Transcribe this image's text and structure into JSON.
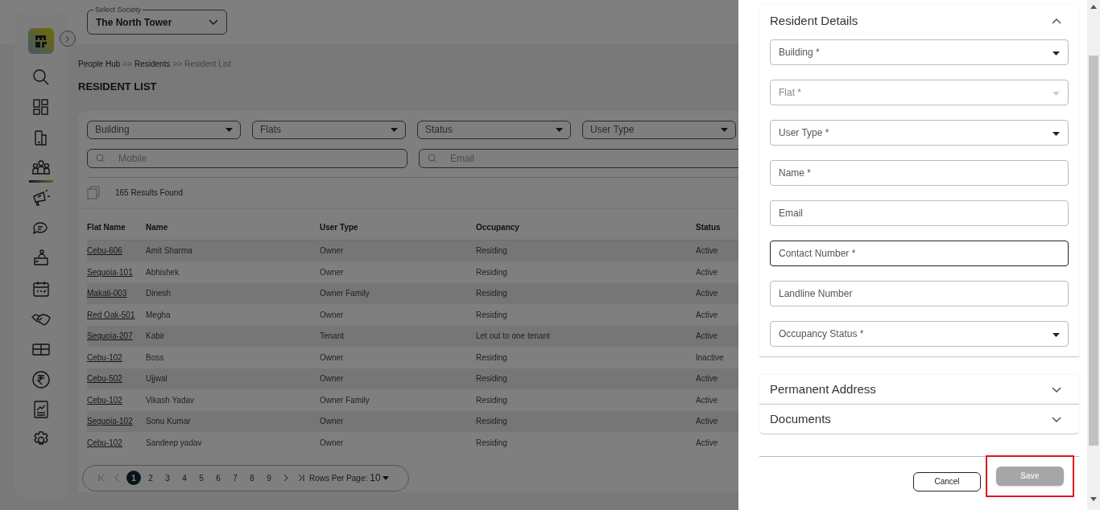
{
  "society_select": {
    "label": "Select Society",
    "value": "The North Tower"
  },
  "nav_items": [
    {
      "kind": "search",
      "selected": false
    },
    {
      "kind": "grid",
      "selected": false
    },
    {
      "kind": "building",
      "selected": false
    },
    {
      "kind": "people",
      "selected": true
    },
    {
      "kind": "megaphone",
      "selected": false
    },
    {
      "kind": "chat",
      "selected": false
    },
    {
      "kind": "desk",
      "selected": false
    },
    {
      "kind": "calendar",
      "selected": false
    },
    {
      "kind": "handshake",
      "selected": false
    },
    {
      "kind": "box",
      "selected": false
    },
    {
      "kind": "rupee",
      "selected": false
    },
    {
      "kind": "report",
      "selected": false
    },
    {
      "kind": "settings",
      "selected": false
    }
  ],
  "breadcrumb": [
    {
      "label": "People Hub",
      "current": false
    },
    {
      "label": "Residents",
      "current": false
    },
    {
      "label": "Resident List",
      "current": true
    }
  ],
  "breadcrumb_separator": ">>",
  "page_title": "RESIDENT LIST",
  "filters": {
    "dropdowns": [
      "Building",
      "Flats",
      "Status",
      "User Type"
    ],
    "search_fields": [
      {
        "placeholder": "Mobile"
      },
      {
        "placeholder": "Email"
      }
    ]
  },
  "results_count": "165 Results Found",
  "table": {
    "columns": [
      "Flat Name",
      "Name",
      "User Type",
      "Occupancy",
      "Status"
    ],
    "rows": [
      [
        "Cebu-606",
        "Amit Sharma",
        "Owner",
        "Residing",
        "Active"
      ],
      [
        "Sequoia-101",
        "Abhishek",
        "Owner",
        "Residing",
        "Active"
      ],
      [
        "Makati-003",
        "Dinesh",
        "Owner Family",
        "Residing",
        "Active"
      ],
      [
        "Red Oak-501",
        "Megha",
        "Owner",
        "Residing",
        "Active"
      ],
      [
        "Sequoia-207",
        "Kabir",
        "Tenant",
        "Let out to one tenant",
        "Active"
      ],
      [
        "Cebu-102",
        "Boss",
        "Owner",
        "Residing",
        "Inactive"
      ],
      [
        "Cebu-502",
        "Ujjwal",
        "Owner",
        "Residing",
        "Active"
      ],
      [
        "Cebu-102",
        "Vikash Yadav",
        "Owner Family",
        "Residing",
        "Active"
      ],
      [
        "Sequoia-102",
        "Sonu Kumar",
        "Owner",
        "Residing",
        "Active"
      ],
      [
        "Cebu-102",
        "Sandeep yadav",
        "Owner",
        "Residing",
        "Active"
      ]
    ]
  },
  "pagination": {
    "pages": [
      {
        "label": "1",
        "selected": true
      },
      {
        "label": "2",
        "selected": false
      },
      {
        "label": "3",
        "selected": false
      },
      {
        "label": "4",
        "selected": false
      },
      {
        "label": "5",
        "selected": false
      },
      {
        "label": "6",
        "selected": false
      },
      {
        "label": "7",
        "selected": false
      },
      {
        "label": "8",
        "selected": false
      },
      {
        "label": "9",
        "selected": false
      }
    ],
    "rows_per_page_label": "Rows Per Page:",
    "rows_per_page": "10"
  },
  "drawer": {
    "sections": [
      {
        "title": "Resident Details",
        "expanded": true,
        "fields": [
          {
            "label": "Building *",
            "kind": "select",
            "disabled": false,
            "focused": false
          },
          {
            "label": "Flat *",
            "kind": "select",
            "disabled": true,
            "focused": false
          },
          {
            "label": "User Type *",
            "kind": "select",
            "disabled": false,
            "focused": false
          },
          {
            "label": "Name *",
            "kind": "text",
            "disabled": false,
            "focused": false
          },
          {
            "label": "Email",
            "kind": "text",
            "disabled": false,
            "focused": false
          },
          {
            "label": "Contact Number *",
            "kind": "text",
            "disabled": false,
            "focused": true
          },
          {
            "label": "Landline Number",
            "kind": "text",
            "disabled": false,
            "focused": false
          },
          {
            "label": "Occupancy Status *",
            "kind": "select",
            "disabled": false,
            "focused": false
          }
        ]
      },
      {
        "title": "Permanent Address",
        "expanded": false
      },
      {
        "title": "Documents",
        "expanded": false
      }
    ],
    "actions": [
      {
        "label": "Cancel",
        "kind": "outline",
        "disabled": false,
        "highlighted": false
      },
      {
        "label": "Save",
        "kind": "filled",
        "disabled": true,
        "highlighted": true
      }
    ]
  }
}
